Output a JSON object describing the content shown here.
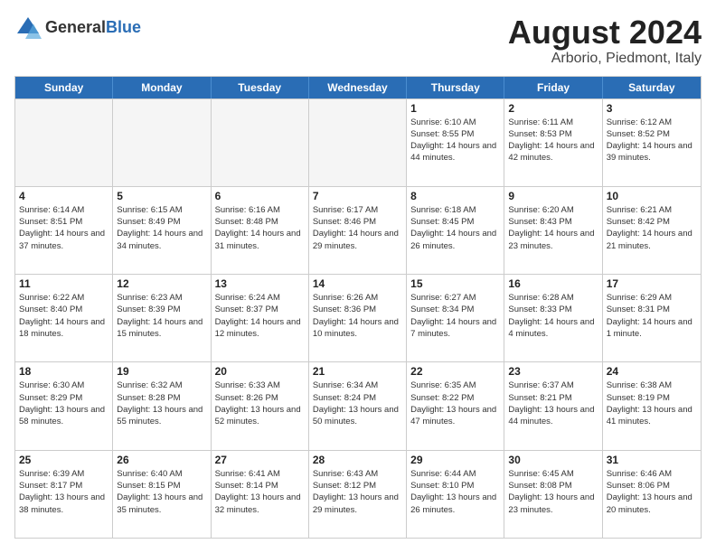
{
  "header": {
    "logo_general": "General",
    "logo_blue": "Blue",
    "month_year": "August 2024",
    "location": "Arborio, Piedmont, Italy"
  },
  "days_of_week": [
    "Sunday",
    "Monday",
    "Tuesday",
    "Wednesday",
    "Thursday",
    "Friday",
    "Saturday"
  ],
  "rows": [
    [
      {
        "day": "",
        "empty": true
      },
      {
        "day": "",
        "empty": true
      },
      {
        "day": "",
        "empty": true
      },
      {
        "day": "",
        "empty": true
      },
      {
        "day": "1",
        "sunrise": "Sunrise: 6:10 AM",
        "sunset": "Sunset: 8:55 PM",
        "daylight": "Daylight: 14 hours and 44 minutes."
      },
      {
        "day": "2",
        "sunrise": "Sunrise: 6:11 AM",
        "sunset": "Sunset: 8:53 PM",
        "daylight": "Daylight: 14 hours and 42 minutes."
      },
      {
        "day": "3",
        "sunrise": "Sunrise: 6:12 AM",
        "sunset": "Sunset: 8:52 PM",
        "daylight": "Daylight: 14 hours and 39 minutes."
      }
    ],
    [
      {
        "day": "4",
        "sunrise": "Sunrise: 6:14 AM",
        "sunset": "Sunset: 8:51 PM",
        "daylight": "Daylight: 14 hours and 37 minutes."
      },
      {
        "day": "5",
        "sunrise": "Sunrise: 6:15 AM",
        "sunset": "Sunset: 8:49 PM",
        "daylight": "Daylight: 14 hours and 34 minutes."
      },
      {
        "day": "6",
        "sunrise": "Sunrise: 6:16 AM",
        "sunset": "Sunset: 8:48 PM",
        "daylight": "Daylight: 14 hours and 31 minutes."
      },
      {
        "day": "7",
        "sunrise": "Sunrise: 6:17 AM",
        "sunset": "Sunset: 8:46 PM",
        "daylight": "Daylight: 14 hours and 29 minutes."
      },
      {
        "day": "8",
        "sunrise": "Sunrise: 6:18 AM",
        "sunset": "Sunset: 8:45 PM",
        "daylight": "Daylight: 14 hours and 26 minutes."
      },
      {
        "day": "9",
        "sunrise": "Sunrise: 6:20 AM",
        "sunset": "Sunset: 8:43 PM",
        "daylight": "Daylight: 14 hours and 23 minutes."
      },
      {
        "day": "10",
        "sunrise": "Sunrise: 6:21 AM",
        "sunset": "Sunset: 8:42 PM",
        "daylight": "Daylight: 14 hours and 21 minutes."
      }
    ],
    [
      {
        "day": "11",
        "sunrise": "Sunrise: 6:22 AM",
        "sunset": "Sunset: 8:40 PM",
        "daylight": "Daylight: 14 hours and 18 minutes."
      },
      {
        "day": "12",
        "sunrise": "Sunrise: 6:23 AM",
        "sunset": "Sunset: 8:39 PM",
        "daylight": "Daylight: 14 hours and 15 minutes."
      },
      {
        "day": "13",
        "sunrise": "Sunrise: 6:24 AM",
        "sunset": "Sunset: 8:37 PM",
        "daylight": "Daylight: 14 hours and 12 minutes."
      },
      {
        "day": "14",
        "sunrise": "Sunrise: 6:26 AM",
        "sunset": "Sunset: 8:36 PM",
        "daylight": "Daylight: 14 hours and 10 minutes."
      },
      {
        "day": "15",
        "sunrise": "Sunrise: 6:27 AM",
        "sunset": "Sunset: 8:34 PM",
        "daylight": "Daylight: 14 hours and 7 minutes."
      },
      {
        "day": "16",
        "sunrise": "Sunrise: 6:28 AM",
        "sunset": "Sunset: 8:33 PM",
        "daylight": "Daylight: 14 hours and 4 minutes."
      },
      {
        "day": "17",
        "sunrise": "Sunrise: 6:29 AM",
        "sunset": "Sunset: 8:31 PM",
        "daylight": "Daylight: 14 hours and 1 minute."
      }
    ],
    [
      {
        "day": "18",
        "sunrise": "Sunrise: 6:30 AM",
        "sunset": "Sunset: 8:29 PM",
        "daylight": "Daylight: 13 hours and 58 minutes."
      },
      {
        "day": "19",
        "sunrise": "Sunrise: 6:32 AM",
        "sunset": "Sunset: 8:28 PM",
        "daylight": "Daylight: 13 hours and 55 minutes."
      },
      {
        "day": "20",
        "sunrise": "Sunrise: 6:33 AM",
        "sunset": "Sunset: 8:26 PM",
        "daylight": "Daylight: 13 hours and 52 minutes."
      },
      {
        "day": "21",
        "sunrise": "Sunrise: 6:34 AM",
        "sunset": "Sunset: 8:24 PM",
        "daylight": "Daylight: 13 hours and 50 minutes."
      },
      {
        "day": "22",
        "sunrise": "Sunrise: 6:35 AM",
        "sunset": "Sunset: 8:22 PM",
        "daylight": "Daylight: 13 hours and 47 minutes."
      },
      {
        "day": "23",
        "sunrise": "Sunrise: 6:37 AM",
        "sunset": "Sunset: 8:21 PM",
        "daylight": "Daylight: 13 hours and 44 minutes."
      },
      {
        "day": "24",
        "sunrise": "Sunrise: 6:38 AM",
        "sunset": "Sunset: 8:19 PM",
        "daylight": "Daylight: 13 hours and 41 minutes."
      }
    ],
    [
      {
        "day": "25",
        "sunrise": "Sunrise: 6:39 AM",
        "sunset": "Sunset: 8:17 PM",
        "daylight": "Daylight: 13 hours and 38 minutes."
      },
      {
        "day": "26",
        "sunrise": "Sunrise: 6:40 AM",
        "sunset": "Sunset: 8:15 PM",
        "daylight": "Daylight: 13 hours and 35 minutes."
      },
      {
        "day": "27",
        "sunrise": "Sunrise: 6:41 AM",
        "sunset": "Sunset: 8:14 PM",
        "daylight": "Daylight: 13 hours and 32 minutes."
      },
      {
        "day": "28",
        "sunrise": "Sunrise: 6:43 AM",
        "sunset": "Sunset: 8:12 PM",
        "daylight": "Daylight: 13 hours and 29 minutes."
      },
      {
        "day": "29",
        "sunrise": "Sunrise: 6:44 AM",
        "sunset": "Sunset: 8:10 PM",
        "daylight": "Daylight: 13 hours and 26 minutes."
      },
      {
        "day": "30",
        "sunrise": "Sunrise: 6:45 AM",
        "sunset": "Sunset: 8:08 PM",
        "daylight": "Daylight: 13 hours and 23 minutes."
      },
      {
        "day": "31",
        "sunrise": "Sunrise: 6:46 AM",
        "sunset": "Sunset: 8:06 PM",
        "daylight": "Daylight: 13 hours and 20 minutes."
      }
    ]
  ]
}
